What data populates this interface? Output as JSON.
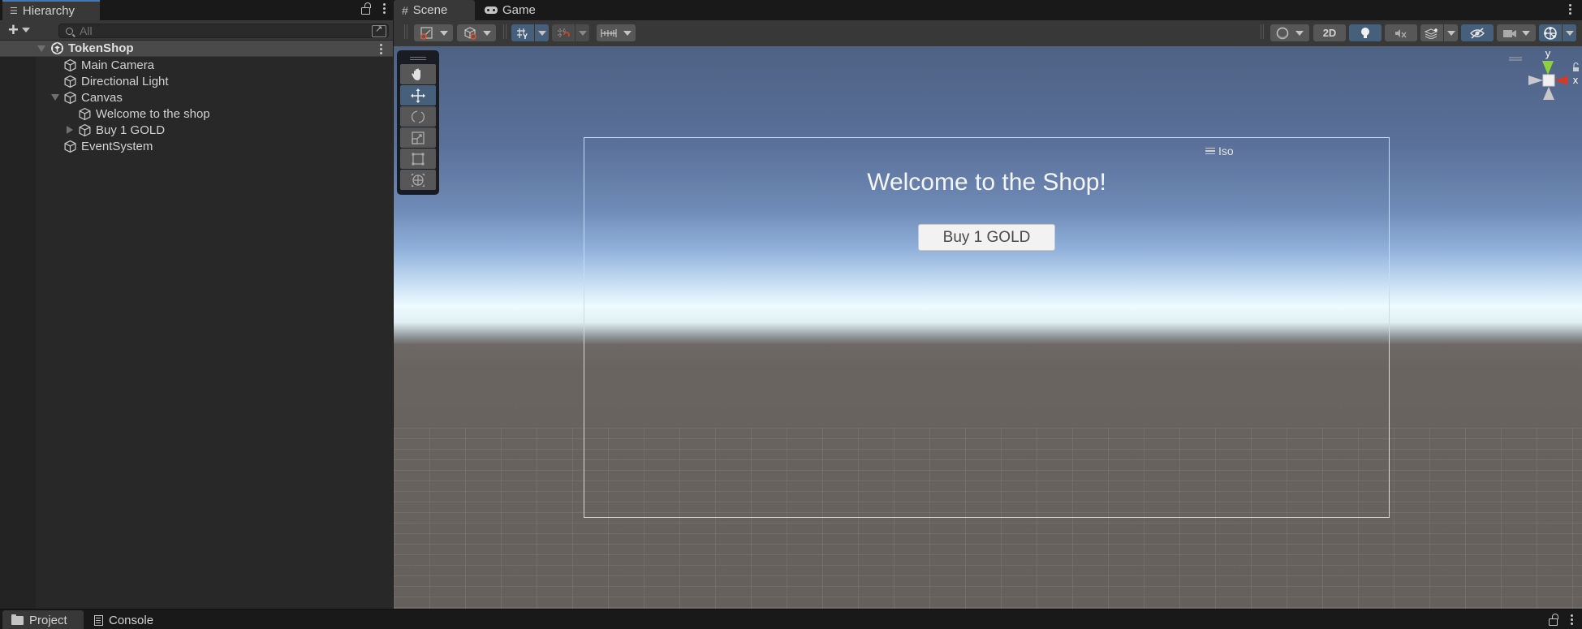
{
  "hierarchy": {
    "tab_label": "Hierarchy",
    "search_placeholder": "All",
    "search_value": "",
    "scene": {
      "label": "TokenShop",
      "expanded": true
    },
    "items": [
      {
        "label": "Main Camera",
        "depth": 1,
        "expandable": false
      },
      {
        "label": "Directional Light",
        "depth": 1,
        "expandable": false
      },
      {
        "label": "Canvas",
        "depth": 1,
        "expandable": true,
        "expanded": true
      },
      {
        "label": "Welcome to the shop",
        "depth": 2,
        "expandable": false
      },
      {
        "label": "Buy 1 GOLD",
        "depth": 2,
        "expandable": true,
        "expanded": false
      },
      {
        "label": "EventSystem",
        "depth": 1,
        "expandable": false
      }
    ]
  },
  "scene_view": {
    "tabs": [
      {
        "label": "Scene",
        "icon": "grid-hash-icon",
        "active": true
      },
      {
        "label": "Game",
        "icon": "gamepad-icon",
        "active": false
      }
    ],
    "toolbar": {
      "draw_mode_2d_label": "2D",
      "toggles": {
        "grid_snapping": true,
        "lighting": true,
        "audio": false,
        "hidden_objects": true,
        "gizmos": true,
        "2d_mode": false
      }
    },
    "tools": [
      {
        "name": "hand-tool",
        "active": false
      },
      {
        "name": "move-tool",
        "active": true
      },
      {
        "name": "rotate-tool",
        "active": false
      },
      {
        "name": "scale-tool",
        "active": false
      },
      {
        "name": "rect-tool",
        "active": false
      },
      {
        "name": "transform-tool",
        "active": false
      }
    ],
    "gizmo": {
      "y_label": "y",
      "x_label": "x",
      "projection_label": "Iso"
    },
    "canvas_content": {
      "title": "Welcome to the Shop!",
      "button_label": "Buy 1 GOLD"
    }
  },
  "bottom_panel": {
    "tabs": [
      {
        "label": "Project",
        "active": true
      },
      {
        "label": "Console",
        "active": false
      }
    ]
  },
  "colors": {
    "accent": "#3a79bb",
    "toggle_on": "#46607c",
    "panel_bg": "#282828",
    "toolbar_bg": "#383838",
    "gizmo_y": "#8cd33b",
    "gizmo_x": "#d23a2a"
  }
}
